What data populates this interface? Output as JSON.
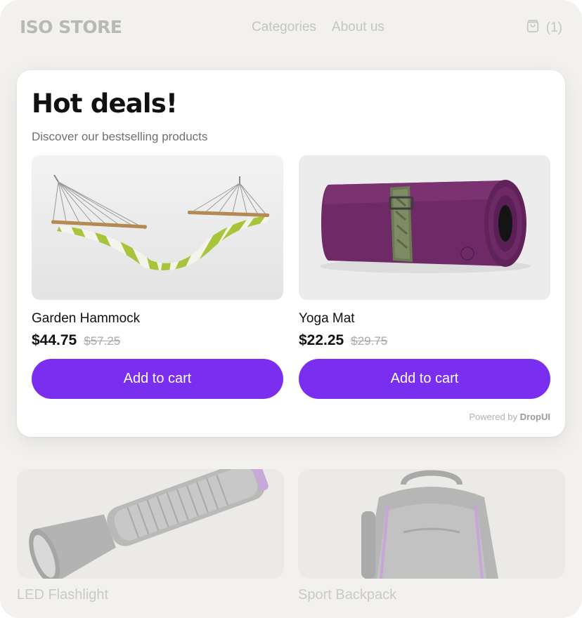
{
  "header": {
    "brand": "ISO STORE",
    "nav": [
      {
        "label": "Categories"
      },
      {
        "label": "About us"
      }
    ],
    "cart_count": "(1)"
  },
  "modal": {
    "title": "Hot deals!",
    "subtitle": "Discover our bestselling products",
    "products": [
      {
        "name": "Garden Hammock",
        "price": "$44.75",
        "old_price": "$57.25",
        "button": "Add to cart",
        "image_icon": "hammock-image"
      },
      {
        "name": "Yoga Mat",
        "price": "$22.25",
        "old_price": "$29.75",
        "button": "Add to cart",
        "image_icon": "yoga-mat-image"
      }
    ],
    "powered_prefix": "Powered by",
    "powered_brand": "DropUI"
  },
  "background_products": [
    {
      "name": "LED Flashlight",
      "image_icon": "flashlight-image"
    },
    {
      "name": "Sport Backpack",
      "image_icon": "backpack-image"
    }
  ],
  "colors": {
    "accent": "#7a2ff0",
    "page_bg": "#f2f1ee",
    "mat": "#6e2a66"
  }
}
